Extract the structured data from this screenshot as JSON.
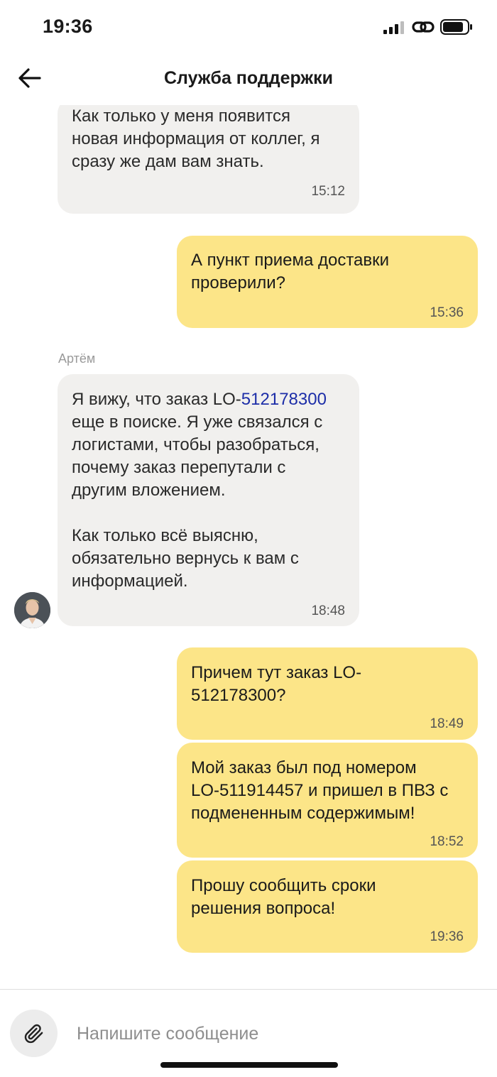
{
  "status_bar": {
    "time": "19:36"
  },
  "header": {
    "title": "Служба поддержки",
    "back_icon": "arrow-left-icon"
  },
  "messages": [
    {
      "direction": "incoming",
      "text": "Как только у меня появится\nновая информация от коллег, я\nсразу же дам вам знать.",
      "time": "15:12"
    },
    {
      "direction": "outgoing",
      "text": "А пункт приема доставки\nпроверили?",
      "time": "15:36"
    },
    {
      "direction": "incoming",
      "sender": "Артём",
      "text_before_link": "Я вижу, что заказ LO-",
      "link": "512178300",
      "text_after_link": "\nеще в поиске. Я уже связался с\nлогистами, чтобы разобраться,\nпочему заказ перепутали с\nдругим вложением.\n\nКак только всё выясню,\nобязательно вернусь к вам с\nинформацией.",
      "time": "18:48"
    },
    {
      "direction": "outgoing",
      "text": "Причем тут заказ LO-\n512178300?",
      "time": "18:49"
    },
    {
      "direction": "outgoing",
      "text": "Мой заказ был под номером\nLO-511914457 и пришел в ПВЗ с\nподмененным содержимым!",
      "time": "18:52"
    },
    {
      "direction": "outgoing",
      "text": "Прошу сообщить сроки\nрешения вопроса!",
      "time": "19:36"
    }
  ],
  "composer": {
    "placeholder": "Напишите сообщение",
    "attach_icon": "paperclip-icon"
  },
  "colors": {
    "incoming_bubble": "#f1f0ee",
    "outgoing_bubble": "#fce588",
    "link": "#1d2ea8"
  }
}
